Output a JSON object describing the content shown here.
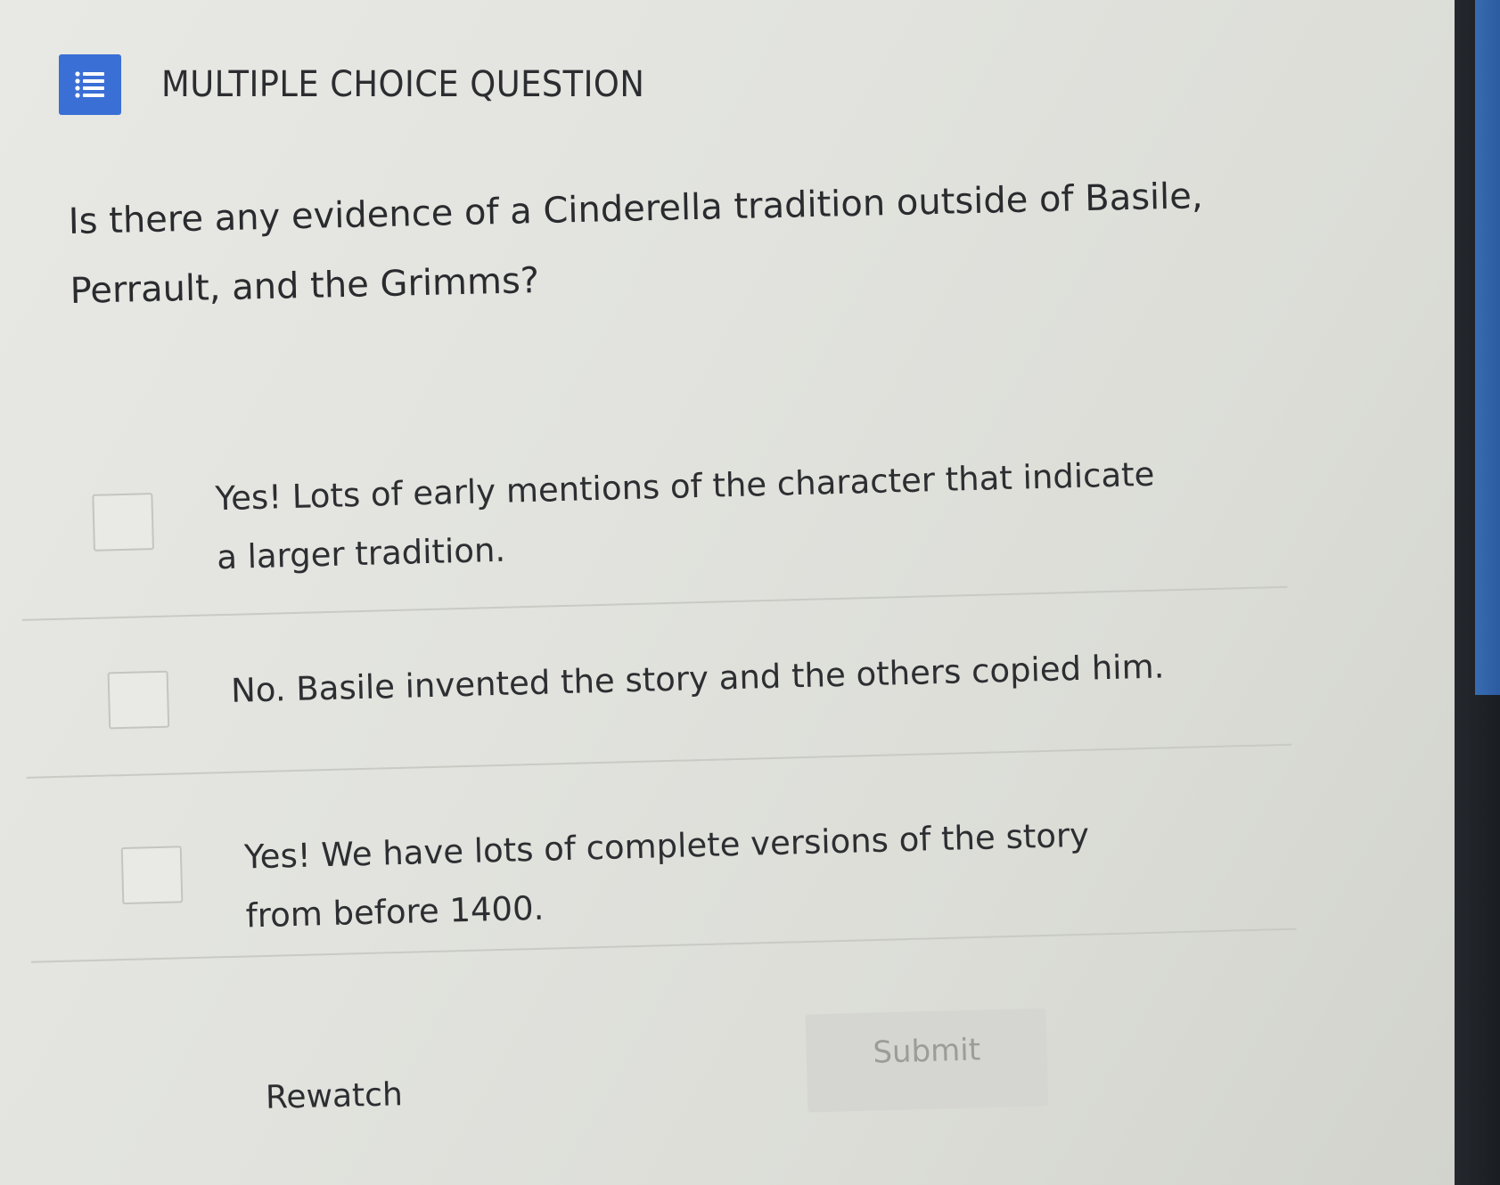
{
  "header": {
    "icon": "list-icon",
    "title": "MULTIPLE CHOICE QUESTION",
    "icon_color": "#3a6fd6"
  },
  "question": {
    "text": "Is there any evidence of a Cinderella tradition outside of Basile, Perrault, and the Grimms?"
  },
  "options": [
    {
      "label": "Yes! Lots of early mentions of the character that indicate a larger tradition.",
      "checked": false
    },
    {
      "label": "No. Basile invented the story and the others copied him.",
      "checked": false
    },
    {
      "label": "Yes! We have lots of complete versions of the story from before 1400.",
      "checked": false
    }
  ],
  "actions": {
    "rewatch_label": "Rewatch",
    "submit_label": "Submit",
    "submit_enabled": false
  }
}
